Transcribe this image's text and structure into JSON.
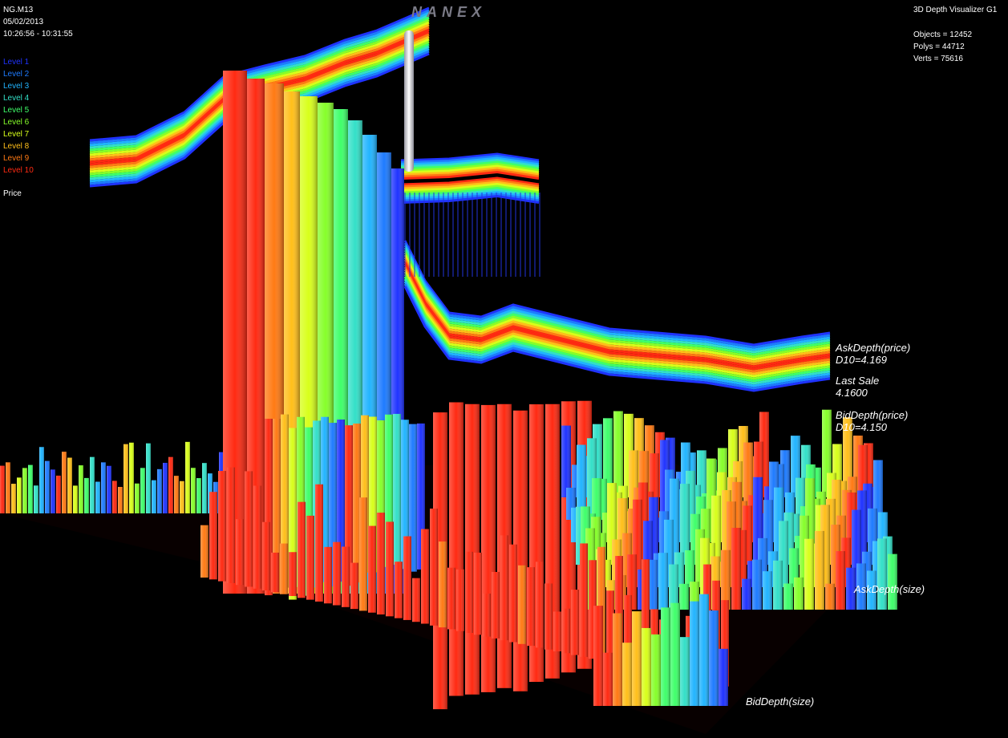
{
  "brand": "NANEX",
  "header_left": {
    "symbol": "NG.M13",
    "date": "05/02/2013",
    "time_range": "10:26:56 - 10:31:55"
  },
  "levels": [
    {
      "label": "Level 1",
      "color": "#1f33ff"
    },
    {
      "label": "Level 2",
      "color": "#1e7bff"
    },
    {
      "label": "Level 3",
      "color": "#21b4ff"
    },
    {
      "label": "Level 4",
      "color": "#33e0c8"
    },
    {
      "label": "Level 5",
      "color": "#3fff6a"
    },
    {
      "label": "Level 6",
      "color": "#86ff2a"
    },
    {
      "label": "Level 7",
      "color": "#d8ff1a"
    },
    {
      "label": "Level 8",
      "color": "#ffbf1a"
    },
    {
      "label": "Level 9",
      "color": "#ff7a14"
    },
    {
      "label": "Level 10",
      "color": "#ff2a12"
    }
  ],
  "price_label": "Price",
  "header_right": {
    "title": "3D Depth Visualizer G1",
    "objects": "Objects = 12452",
    "polys": "Polys = 44712",
    "verts": "Verts = 75616"
  },
  "annotations": {
    "ask_depth_price": "AskDepth(price)",
    "ask_d10": "D10=4.169",
    "last_sale_label": "Last Sale",
    "last_sale_value": "4.1600",
    "bid_depth_price": "BidDepth(price)",
    "bid_d10": "D10=4.150",
    "ask_depth_size": "AskDepth(size)",
    "bid_depth_size": "BidDepth(size)"
  },
  "colors": {
    "background": "#000000",
    "brand": "#7a7a86",
    "last_sale_column": "#d8d8e0"
  }
}
